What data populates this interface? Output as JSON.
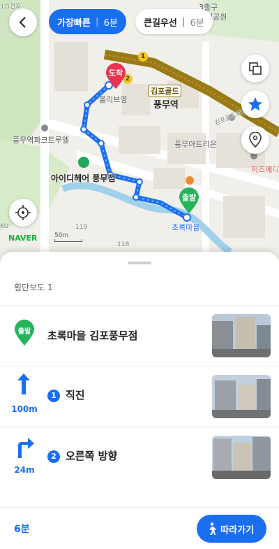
{
  "route_options": {
    "fastest": {
      "label": "가장빠른",
      "duration": "6분"
    },
    "main_road": {
      "label": "큰길우선",
      "duration": "6분"
    }
  },
  "map": {
    "labels": {
      "lg": "LG전자",
      "exit3": "3출구",
      "park": "세이공원",
      "olive": "올리브영",
      "gimpo_gold": "김포골드",
      "station": "풍무역",
      "gimpo_gold_line": "김포골드라인",
      "parktrue": "풍무역파크트루엘",
      "artrion": "풍무아트리온",
      "hizmedi": "히즈메디",
      "idihair": "아이디헤어 풍무점",
      "chorok": "초록마을",
      "num119": "119",
      "num118": "118",
      "ku": "KU"
    },
    "markers": {
      "arrive": "도착",
      "depart": "출발"
    },
    "line_badge": {
      "one": "1",
      "two": "2"
    },
    "brand": "NAVER",
    "scale": "50m"
  },
  "sheet": {
    "header": "횡단보도 1",
    "steps": [
      {
        "title": "초록마을 김포풍무점",
        "badge": "출발"
      },
      {
        "num": "1",
        "title": "직진",
        "distance": "100m"
      },
      {
        "num": "2",
        "title": "오른쪽 방향",
        "distance": "24m"
      }
    ],
    "total_time": "6분",
    "follow_label": "따라가기"
  },
  "colors": {
    "accent": "#1a6ef0",
    "depart_green": "#24b55b",
    "arrive_red": "#e8344e",
    "gold_line": "#9a7a17"
  },
  "icons": [
    "back-icon",
    "layers-icon",
    "star-icon",
    "location-pin-icon",
    "gps-target-icon",
    "straight-arrow-icon",
    "right-turn-icon",
    "walk-icon"
  ]
}
